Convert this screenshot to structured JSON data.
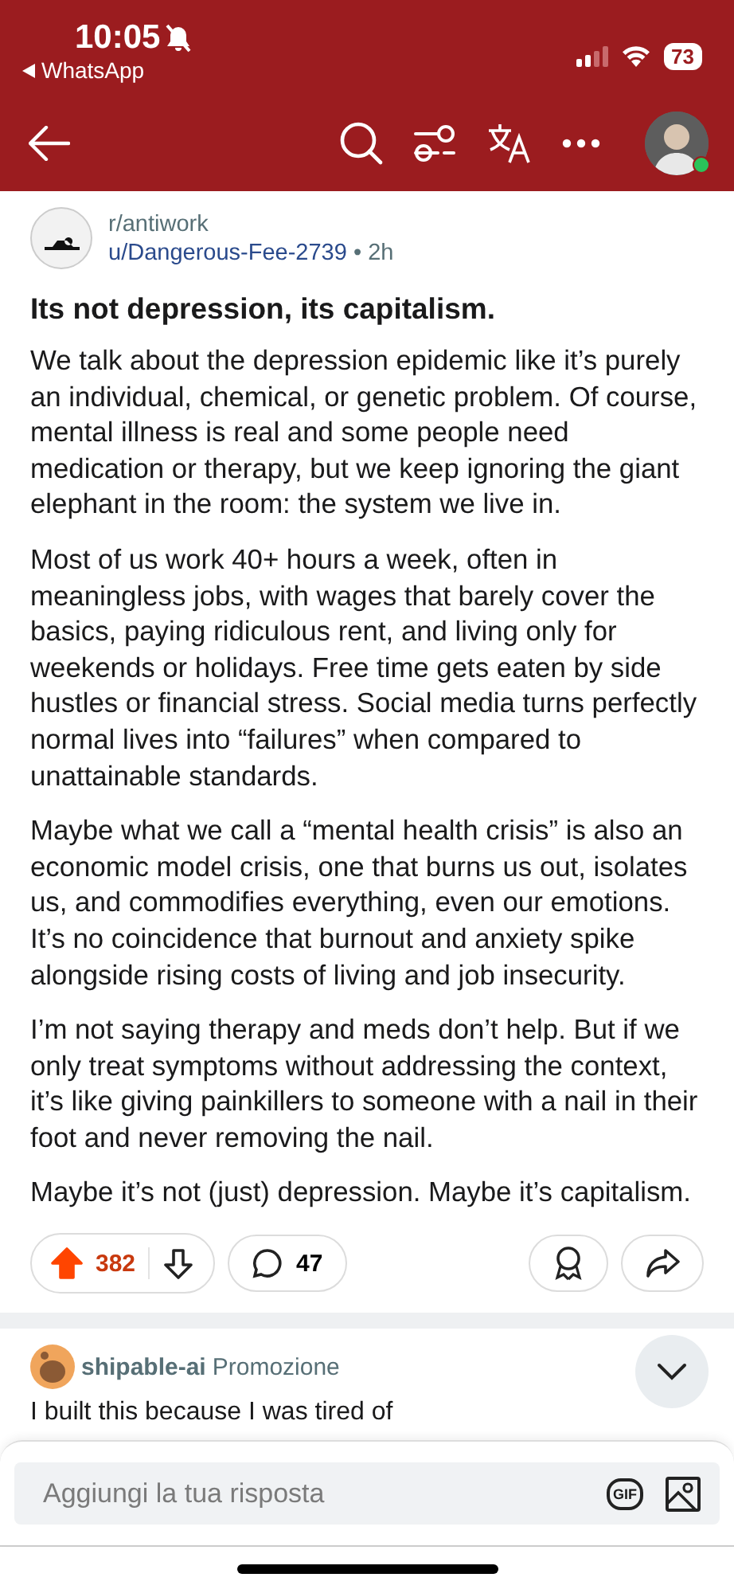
{
  "status_bar": {
    "time": "10:05",
    "back_app": "WhatsApp",
    "battery": "73"
  },
  "post": {
    "subreddit": "r/antiwork",
    "author": "u/Dangerous-Fee-2739",
    "separator": "•",
    "age": "2h",
    "title": "Its not depression, its capitalism.",
    "paragraphs": [
      "We talk about the depression epidemic like it’s purely an individual, chemical, or genetic problem. Of course, mental illness is real and some people need medication or therapy, but we keep ignoring the giant elephant in the room: the system we live in.",
      "Most of us work 40+ hours a week, often in meaningless jobs, with wages that barely cover the basics, paying ridiculous rent, and living only for weekends or holidays. Free time gets eaten by side hustles or financial stress. Social media turns perfectly normal lives into “failures” when compared to unattainable standards.",
      "Maybe what we call a “mental health crisis” is also an economic model crisis, one that burns us out, isolates us, and commodifies everything, even our emotions. It’s no coincidence that burnout and anxiety spike alongside rising costs of living and job insecurity.",
      "I’m not saying therapy and meds don’t help. But if we only treat symptoms without addressing the context, it’s like giving painkillers to someone with a nail in their foot and never removing the nail.",
      "Maybe it’s not (just) depression. Maybe it’s capitalism."
    ],
    "votes": "382",
    "upvoted": true,
    "comments": "47"
  },
  "comment": {
    "author": "shipable-ai",
    "tag": "Promozione",
    "text": "I built this because I was tired of"
  },
  "composer": {
    "placeholder": "Aggiungi la tua risposta",
    "gif": "GIF"
  }
}
